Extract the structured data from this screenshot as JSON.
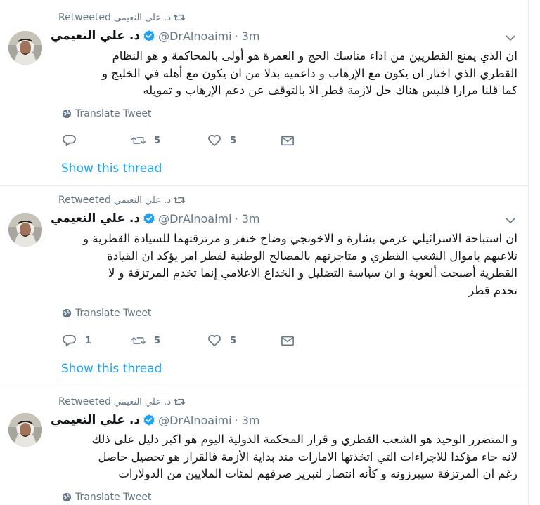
{
  "colors": {
    "link": "#1da1f2",
    "muted": "#657786",
    "text": "#14171a",
    "verified": "#1da1f2"
  },
  "tweets": [
    {
      "retweet_by": "د. علي النعيمي",
      "retweet_label": "Retweeted",
      "author_name": "د. علي النعيمي",
      "handle": "@DrAlnoaimi",
      "time": "· 3m",
      "lines": [
        "ان الذي يمنع القطريين من اداء مناسك الحج و العمرة هو أولى بالمحاكمة و هو النظام",
        "القطري الذي اختار ان يكون مع الإرهاب و داعميه بدلا من ان يكون مع أهله في الخليج و",
        "كما قلنا مرارا فليس هناك حل لازمة قطر الا بالتوقف عن دعم الإرهاب و تمويله"
      ],
      "translate": "Translate Tweet",
      "reply_count": "",
      "retweet_count": "5",
      "like_count": "5",
      "show_thread": "Show this thread"
    },
    {
      "retweet_by": "د. علي النعيمي",
      "retweet_label": "Retweeted",
      "author_name": "د. علي النعيمي",
      "handle": "@DrAlnoaimi",
      "time": "· 3m",
      "lines": [
        "ان استباحة الاسرائيلي عزمي بشارة و الاخونجي وضاح خنفر  و مرتزقتهما للسيادة القطرية و",
        "تلاعبهم باموال الشعب القطري و متاجرتهم بالمصالح الوطنية لقطر امر يؤكد ان القيادة",
        "القطرية أصبحت ألعوبة و ان سياسة التضليل و الخداع الاعلامي إنما تخدم المرتزقة و لا",
        "تخدم قطر"
      ],
      "translate": "Translate Tweet",
      "reply_count": "1",
      "retweet_count": "5",
      "like_count": "5",
      "show_thread": "Show this thread"
    },
    {
      "retweet_by": "د. علي النعيمي",
      "retweet_label": "Retweeted",
      "author_name": "د. علي النعيمي",
      "handle": "@DrAlnoaimi",
      "time": "· 3m",
      "lines": [
        "و المتضرر الوحيد هو الشعب القطري و قرار المحكمة الدولية اليوم هو اكبر دليل على ذلك",
        "لانه جاء مؤكدا للاجراءات التي اتخذتها الامارات منذ بداية الأزمة فالقرار هو تحصيل حاصل",
        "رغم ان المرتزقة سيبرزونه و كأنه انتصار لتبرير صرفهم لمئات الملايين من الدولارات"
      ],
      "translate": "Translate Tweet"
    }
  ],
  "icons": {
    "retweet": "retweet-icon",
    "reply": "reply-icon",
    "like": "heart-icon",
    "dm": "envelope-icon",
    "globe": "globe-icon",
    "caret": "chevron-down-icon",
    "verified": "verified-badge-icon"
  }
}
